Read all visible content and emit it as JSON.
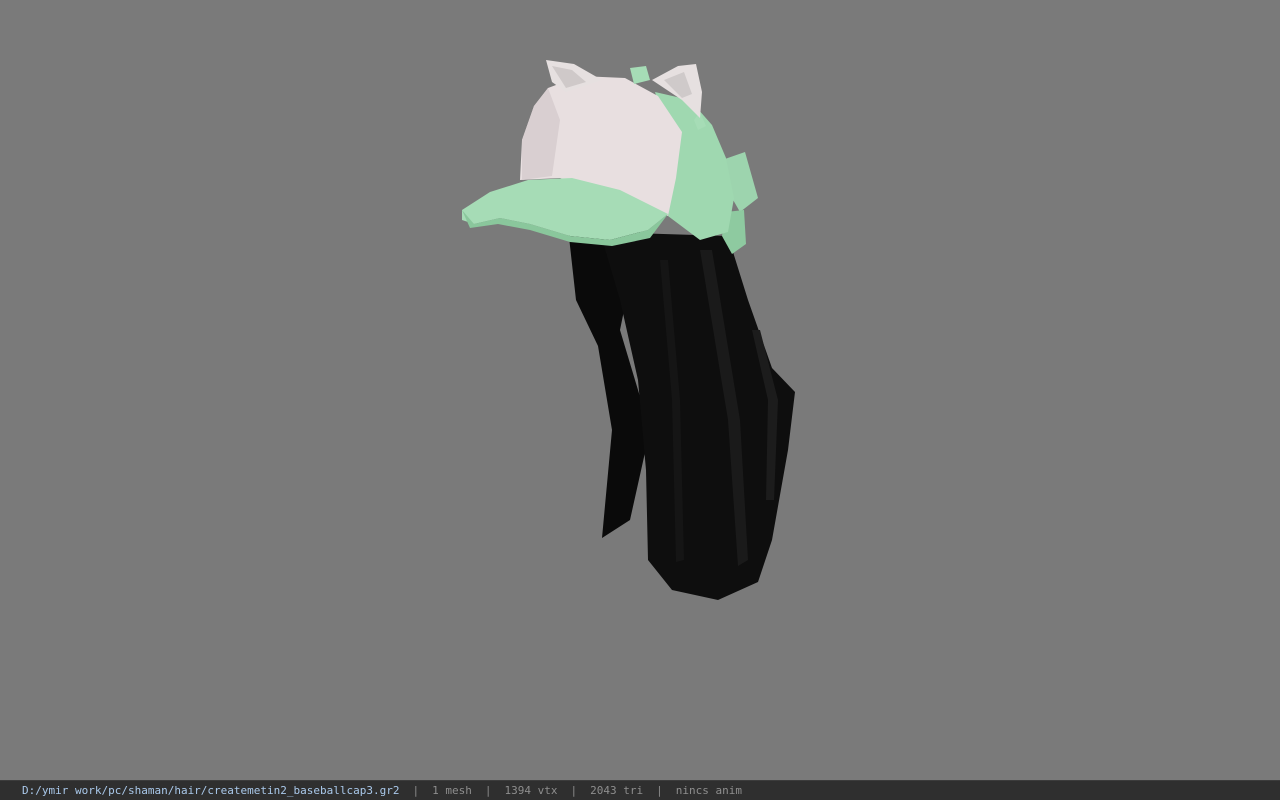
{
  "viewport": {
    "background_color": "#7a7a7a",
    "model": {
      "hair_color": "#0a0a0a",
      "cap_crown_color": "#e8dfe0",
      "cap_trim_color": "#a6dcb6"
    }
  },
  "statusbar": {
    "path": "D:/ymir work/pc/shaman/hair/createmetin2_baseballcap3.gr2",
    "separator": "|",
    "mesh": "1 mesh",
    "vertices": "1394 vtx",
    "triangles": "2043 tri",
    "animation": "nincs anim"
  }
}
